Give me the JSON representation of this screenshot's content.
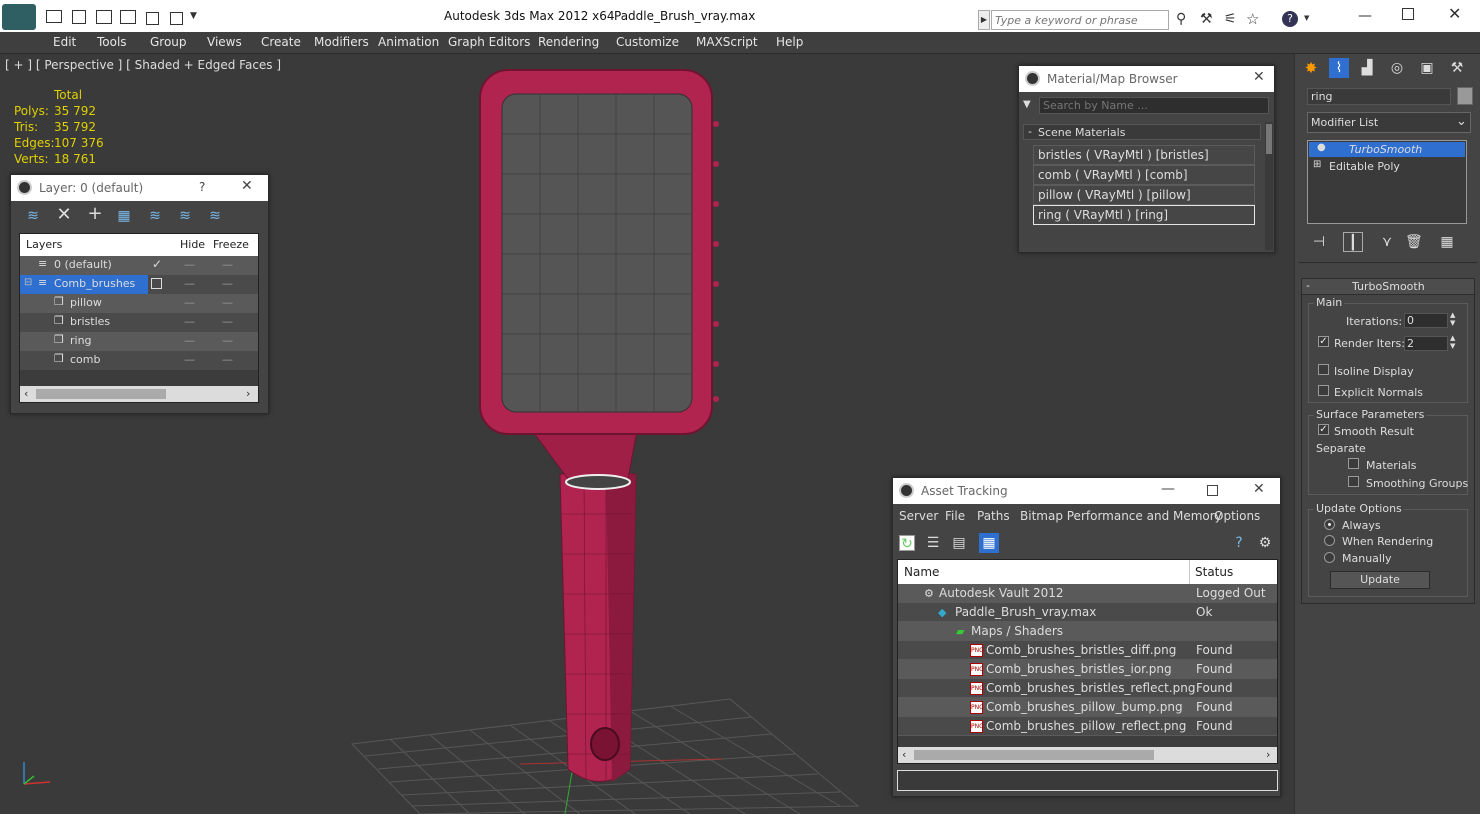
{
  "titlebar": {
    "app_title": "Autodesk 3ds Max  2012 x64",
    "file_name": "Paddle_Brush_vray.max",
    "search_placeholder": "Type a keyword or phrase"
  },
  "menu": [
    "Edit",
    "Tools",
    "Group",
    "Views",
    "Create",
    "Modifiers",
    "Animation",
    "Graph Editors",
    "Rendering",
    "Customize",
    "MAXScript",
    "Help"
  ],
  "viewport": {
    "label": "[ + ] [ Perspective ] [ Shaded + Edged Faces ]",
    "stats": {
      "header": "Total",
      "polys_label": "Polys:",
      "polys": "35 792",
      "tris_label": "Tris:",
      "tris": "35 792",
      "edges_label": "Edges:",
      "edges": "107 376",
      "verts_label": "Verts:",
      "verts": "18 761"
    }
  },
  "layer_window": {
    "title": "Layer: 0 (default)",
    "help": "?",
    "columns": [
      "Layers",
      "Hide",
      "Freeze"
    ],
    "rows": [
      "0 (default)",
      "Comb_brushes",
      "pillow",
      "bristles",
      "ring",
      "comb"
    ]
  },
  "material_browser": {
    "title": "Material/Map Browser",
    "search_placeholder": "Search by Name ...",
    "section": "Scene Materials",
    "items": [
      "bristles  ( VRayMtl ) [bristles]",
      "comb  ( VRayMtl ) [comb]",
      "pillow  ( VRayMtl ) [pillow]",
      "ring  ( VRayMtl ) [ring]"
    ]
  },
  "asset_tracking": {
    "title": "Asset Tracking",
    "menu": [
      "Server",
      "File",
      "Paths",
      "Bitmap Performance and Memory",
      "Options"
    ],
    "col_name": "Name",
    "col_status": "Status",
    "rows": [
      {
        "name": "Autodesk Vault 2012",
        "status": "Logged Out ..."
      },
      {
        "name": "Paddle_Brush_vray.max",
        "status": "Ok"
      },
      {
        "name": "Maps / Shaders",
        "status": ""
      },
      {
        "name": "Comb_brushes_bristles_diff.png",
        "status": "Found"
      },
      {
        "name": "Comb_brushes_bristles_ior.png",
        "status": "Found"
      },
      {
        "name": "Comb_brushes_bristles_reflect.png",
        "status": "Found"
      },
      {
        "name": "Comb_brushes_pillow_bump.png",
        "status": "Found"
      },
      {
        "name": "Comb_brushes_pillow_reflect.png",
        "status": "Found"
      }
    ]
  },
  "command_panel": {
    "object_name": "ring",
    "modifier_list": "Modifier List",
    "stack": [
      "TurboSmooth",
      "Editable Poly"
    ],
    "rollout_title": "TurboSmooth",
    "main_group": "Main",
    "iterations_label": "Iterations:",
    "iterations": "0",
    "render_iters_label": "Render Iters:",
    "render_iters": "2",
    "isoline": "Isoline Display",
    "explicit_normals": "Explicit Normals",
    "surface_group": "Surface Parameters",
    "smooth_result": "Smooth Result",
    "separate": "Separate",
    "materials": "Materials",
    "smoothing_groups": "Smoothing Groups",
    "update_group": "Update Options",
    "always": "Always",
    "when_rendering": "When Rendering",
    "manually": "Manually",
    "update_button": "Update"
  },
  "colors": {
    "brush": "#b0244f",
    "selection": "#2f6fd0",
    "stats": "#e0d000"
  }
}
